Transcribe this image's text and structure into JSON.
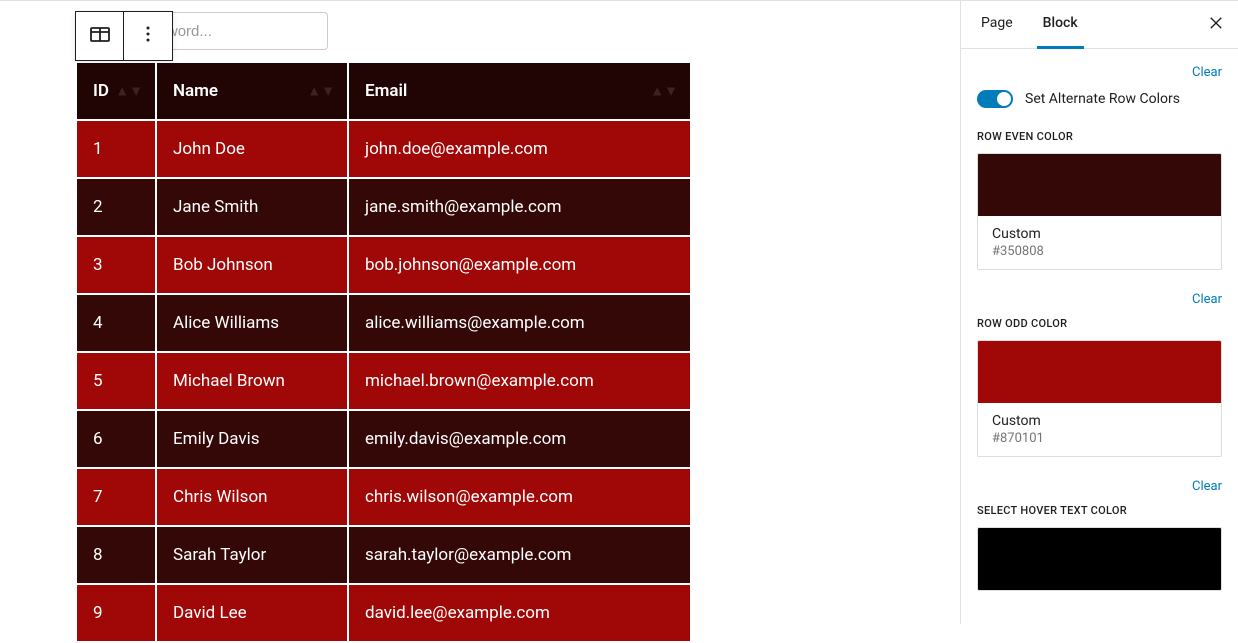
{
  "search": {
    "placeholder": "Enter a keyword..."
  },
  "table": {
    "headers": [
      "ID",
      "Name",
      "Email"
    ],
    "rows": [
      {
        "id": "1",
        "name": "John Doe",
        "email": "john.doe@example.com"
      },
      {
        "id": "2",
        "name": "Jane Smith",
        "email": "jane.smith@example.com"
      },
      {
        "id": "3",
        "name": "Bob Johnson",
        "email": "bob.johnson@example.com"
      },
      {
        "id": "4",
        "name": "Alice Williams",
        "email": "alice.williams@example.com"
      },
      {
        "id": "5",
        "name": "Michael Brown",
        "email": "michael.brown@example.com"
      },
      {
        "id": "6",
        "name": "Emily Davis",
        "email": "emily.davis@example.com"
      },
      {
        "id": "7",
        "name": "Chris Wilson",
        "email": "chris.wilson@example.com"
      },
      {
        "id": "8",
        "name": "Sarah Taylor",
        "email": "sarah.taylor@example.com"
      },
      {
        "id": "9",
        "name": "David Lee",
        "email": "david.lee@example.com"
      }
    ]
  },
  "sidebar": {
    "tabs": {
      "page": "Page",
      "block": "Block"
    },
    "clear": "Clear",
    "alternateRows": {
      "label": "Set Alternate Row Colors"
    },
    "sections": {
      "even": {
        "label": "ROW EVEN COLOR",
        "custom": "Custom",
        "hex": "#350808"
      },
      "odd": {
        "label": "ROW ODD COLOR",
        "custom": "Custom",
        "hex": "#870101"
      },
      "hover": {
        "label": "SELECT HOVER TEXT COLOR"
      }
    }
  }
}
